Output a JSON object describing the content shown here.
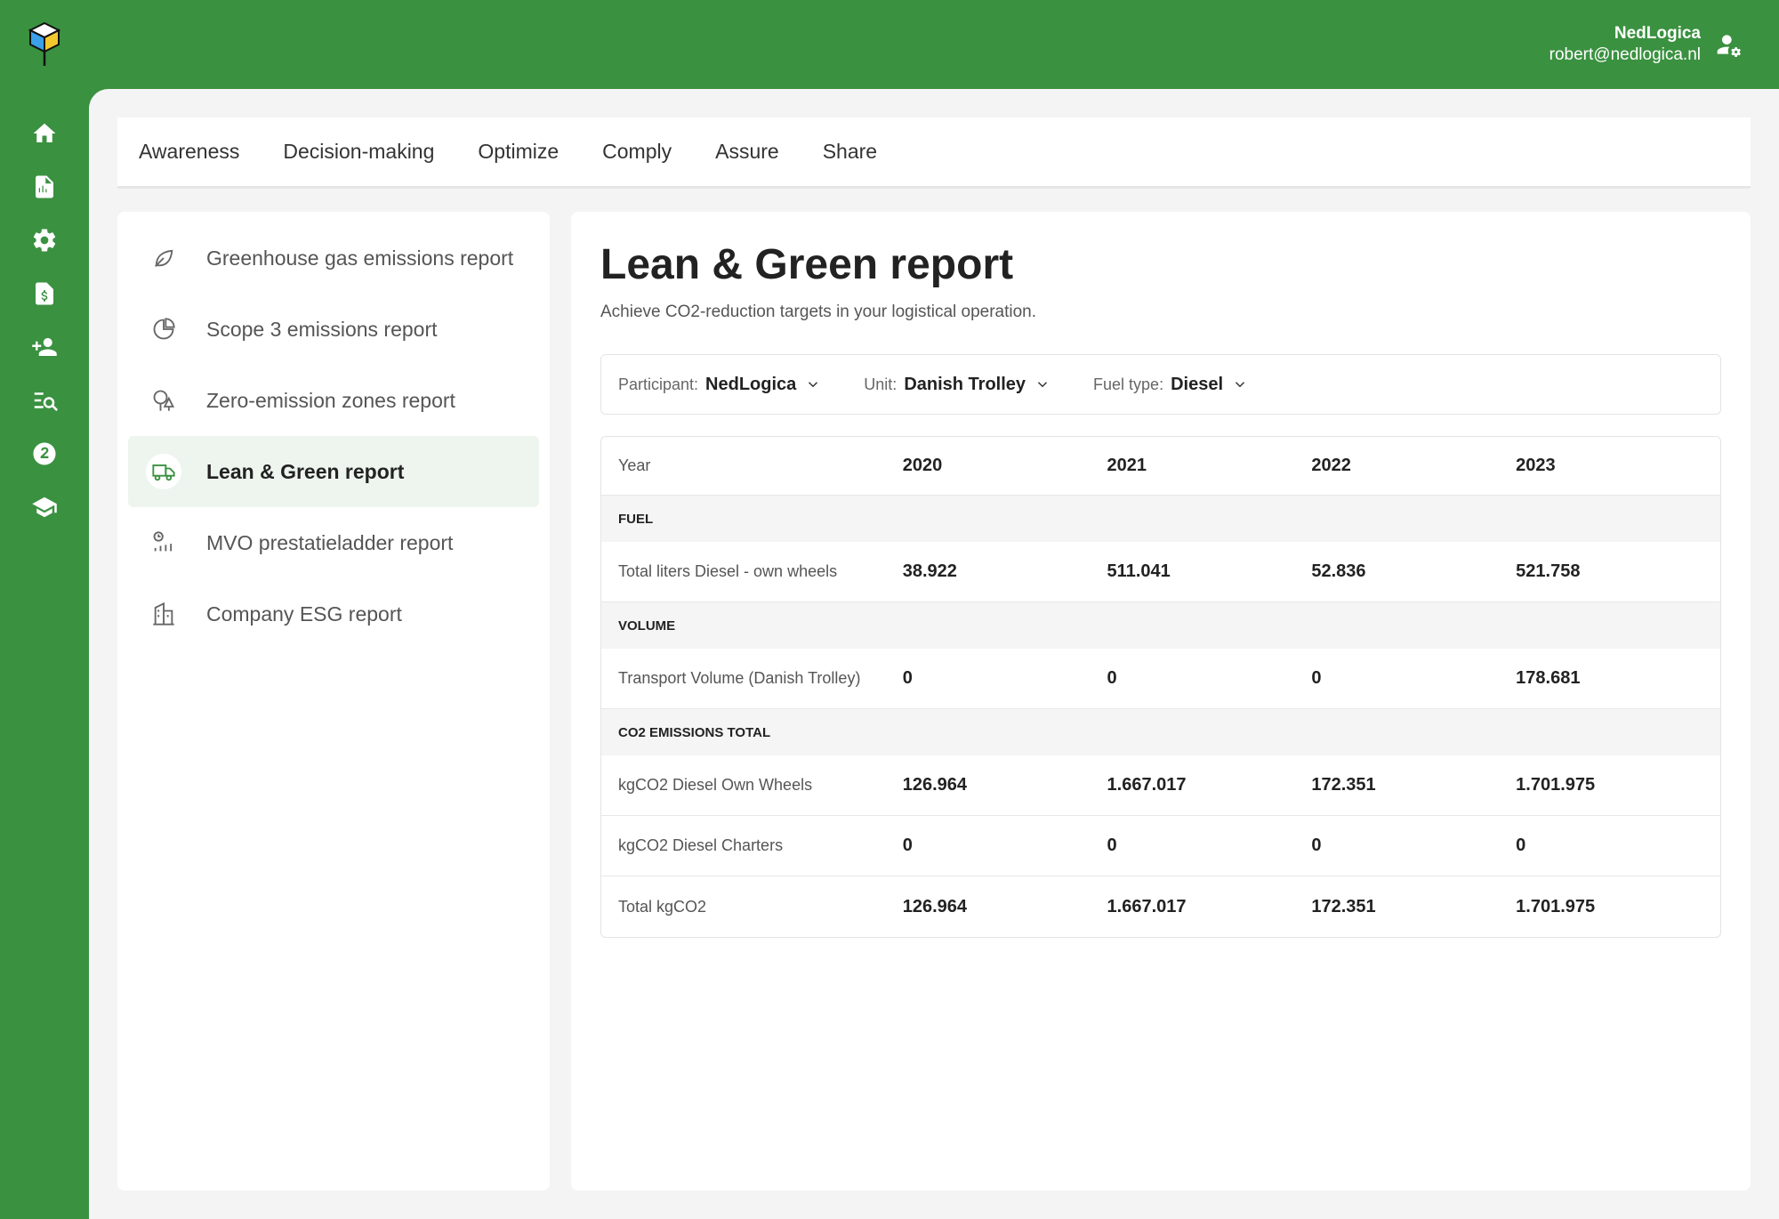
{
  "header": {
    "org": "NedLogica",
    "email": "robert@nedlogica.nl"
  },
  "sidebar": {
    "icons": [
      "home-icon",
      "report-icon",
      "settings-gear-icon",
      "invoice-icon",
      "add-user-icon",
      "search-list-icon",
      "currency-icon",
      "education-icon"
    ]
  },
  "topnav": {
    "tabs": [
      "Awareness",
      "Decision-making",
      "Optimize",
      "Comply",
      "Assure",
      "Share"
    ]
  },
  "reports": [
    {
      "label": "Greenhouse gas emissions report",
      "icon": "leaf-icon",
      "active": false
    },
    {
      "label": "Scope 3 emissions report",
      "icon": "pie-chart-icon",
      "active": false
    },
    {
      "label": "Zero-emission zones report",
      "icon": "trees-icon",
      "active": false
    },
    {
      "label": "Lean & Green report",
      "icon": "truck-icon",
      "active": true
    },
    {
      "label": "MVO prestatieladder report",
      "icon": "ladder-chart-icon",
      "active": false
    },
    {
      "label": "Company ESG report",
      "icon": "building-icon",
      "active": false
    }
  ],
  "content": {
    "title": "Lean & Green report",
    "subtitle": "Achieve CO2-reduction targets in your logistical operation."
  },
  "filters": {
    "participant": {
      "label": "Participant:",
      "value": "NedLogica"
    },
    "unit": {
      "label": "Unit:",
      "value": "Danish Trolley"
    },
    "fuel": {
      "label": "Fuel type:",
      "value": "Diesel"
    }
  },
  "table": {
    "year_label": "Year",
    "years": [
      "2020",
      "2021",
      "2022",
      "2023"
    ],
    "sections": {
      "fuel": "FUEL",
      "volume": "VOLUME",
      "co2": "CO2 EMISSIONS TOTAL"
    },
    "rows": {
      "liters": {
        "label": "Total liters Diesel - own wheels",
        "values": [
          "38.922",
          "511.041",
          "52.836",
          "521.758"
        ]
      },
      "transport": {
        "label": "Transport Volume (Danish Trolley)",
        "values": [
          "0",
          "0",
          "0",
          "178.681"
        ]
      },
      "own_wheels": {
        "label": "kgCO2 Diesel Own Wheels",
        "values": [
          "126.964",
          "1.667.017",
          "172.351",
          "1.701.975"
        ]
      },
      "charters": {
        "label": "kgCO2 Diesel Charters",
        "values": [
          "0",
          "0",
          "0",
          "0"
        ]
      },
      "total": {
        "label": "Total kgCO2",
        "values": [
          "126.964",
          "1.667.017",
          "172.351",
          "1.701.975"
        ]
      }
    }
  },
  "colors": {
    "brand_green": "#3a9140",
    "active_bg": "#eef5ef"
  }
}
